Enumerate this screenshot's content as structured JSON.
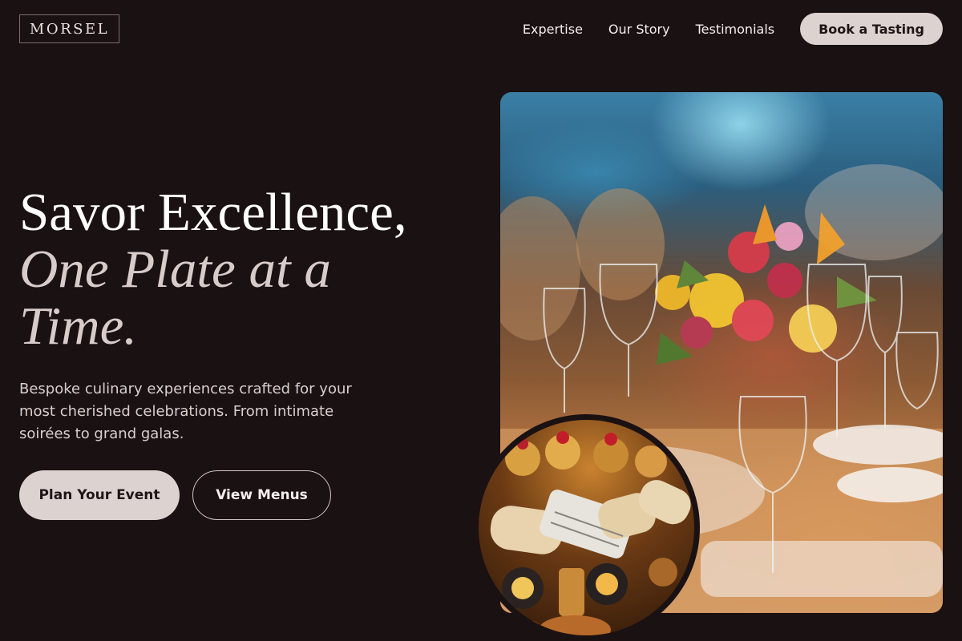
{
  "header": {
    "logo": "MORSEL",
    "nav": [
      {
        "label": "Expertise"
      },
      {
        "label": "Our Story"
      },
      {
        "label": "Testimonials"
      }
    ],
    "cta_label": "Book a Tasting"
  },
  "hero": {
    "title_line1": "Savor Excellence,",
    "title_line2": "One Plate at a Time.",
    "description": "Bespoke culinary experiences crafted for your most cherished celebrations. From intimate soirées to grand galas.",
    "primary_button": "Plan Your Event",
    "secondary_button": "View Menus"
  },
  "images": {
    "main_photo": "banquet-table-with-flowers-and-wine-glasses",
    "inset_photo": "catering-canapes-platter"
  },
  "colors": {
    "background": "#1a1112",
    "button_fill": "#dcd2d0",
    "italic_text": "#d8cccb"
  }
}
